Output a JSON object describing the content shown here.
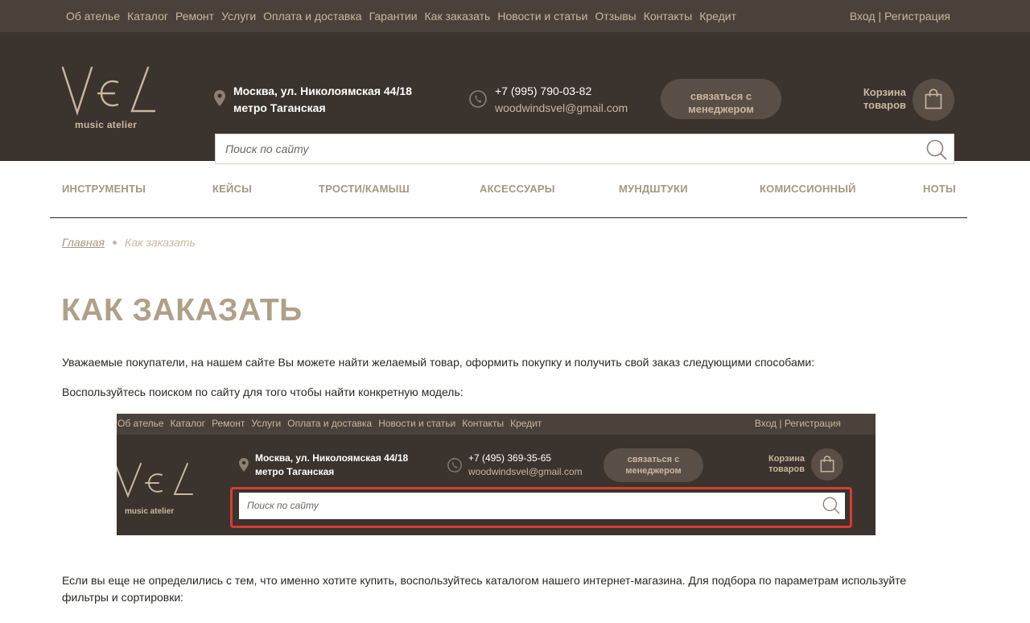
{
  "topbar": {
    "links": [
      "Об ателье",
      "Каталог",
      "Ремонт",
      "Услуги",
      "Оплата и доставка",
      "Гарантии",
      "Как заказать",
      "Новости и статьи",
      "Отзывы",
      "Контакты",
      "Кредит"
    ],
    "login": "Вход",
    "separator": "|",
    "register": "Регистрация"
  },
  "header": {
    "logo_text": "music atelier",
    "address_line1": "Москва, ул. Николоямская 44/18",
    "address_line2": "метро Таганская",
    "phone": "+7 (995) 790-03-82",
    "email": "woodwindsvel@gmail.com",
    "manager_line1": "связаться с",
    "manager_line2": "менеджером",
    "cart_line1": "Корзина",
    "cart_line2": "товаров",
    "search_placeholder": "Поиск по сайту"
  },
  "categories": [
    "ИНСТРУМЕНТЫ",
    "КЕЙСЫ",
    "ТРОСТИ/КАМЫШ",
    "АКСЕССУАРЫ",
    "МУНДШТУКИ",
    "КОМИССИОННЫЙ",
    "НОТЫ"
  ],
  "breadcrumb": {
    "home": "Главная",
    "current": "Как заказать"
  },
  "page": {
    "title": "КАК ЗАКАЗАТЬ",
    "intro": "Уважаемые покупатели, на нашем сайте Вы можете найти желаемый товар, оформить покупку и получить свой заказ следующими способами:",
    "search_hint": "Воспользуйтесь поиском по сайту для того чтобы найти конкретную модель:",
    "catalog_hint": "Если вы еще не определились с тем, что именно хотите купить, воспользуйтесь каталогом нашего интернет-магазина. Для подбора по параметрам используйте фильтры и сортировки:"
  },
  "screenshot": {
    "links": [
      "Об ателье",
      "Каталог",
      "Ремонт",
      "Услуги",
      "Оплата и доставка",
      "Новости и статьи",
      "Контакты",
      "Кредит"
    ],
    "auth": "Вход | Регистрация",
    "logo_text": "music atelier",
    "address_line1": "Москва, ул. Николоямская 44/18",
    "address_line2": "метро Таганская",
    "phone": "+7 (495) 369-35-65",
    "email": "woodwindsvel@gmail.com",
    "manager_line1": "связаться с",
    "manager_line2": "менеджером",
    "cart_line1": "Корзина",
    "cart_line2": "товаров",
    "search_placeholder": "Поиск по сайту"
  },
  "colors": {
    "topbar_bg": "#4a413b",
    "header_bg": "#3a332e",
    "accent_beige": "#c9b89f",
    "title_color": "#b0a089",
    "highlight_red": "#d73c33"
  }
}
